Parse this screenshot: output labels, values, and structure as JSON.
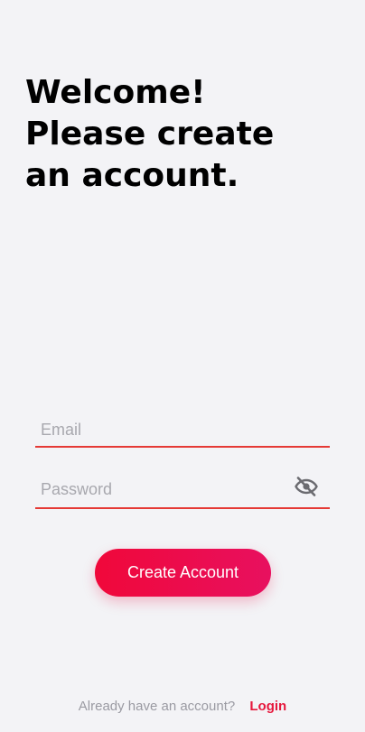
{
  "headline": {
    "line1": "Welcome!",
    "line2": "Please create",
    "line3": "an account."
  },
  "form": {
    "email_placeholder": "Email",
    "password_placeholder": "Password",
    "submit_label": "Create Account"
  },
  "footer": {
    "prompt": "Already have an account?",
    "login_link": "Login"
  },
  "icons": {
    "password_toggle": "eye-off-icon"
  },
  "colors": {
    "accent": "#e53935",
    "button_start": "#f0083a",
    "button_end": "#e8105f",
    "link": "#e6173c",
    "background": "#f3f3f6"
  }
}
